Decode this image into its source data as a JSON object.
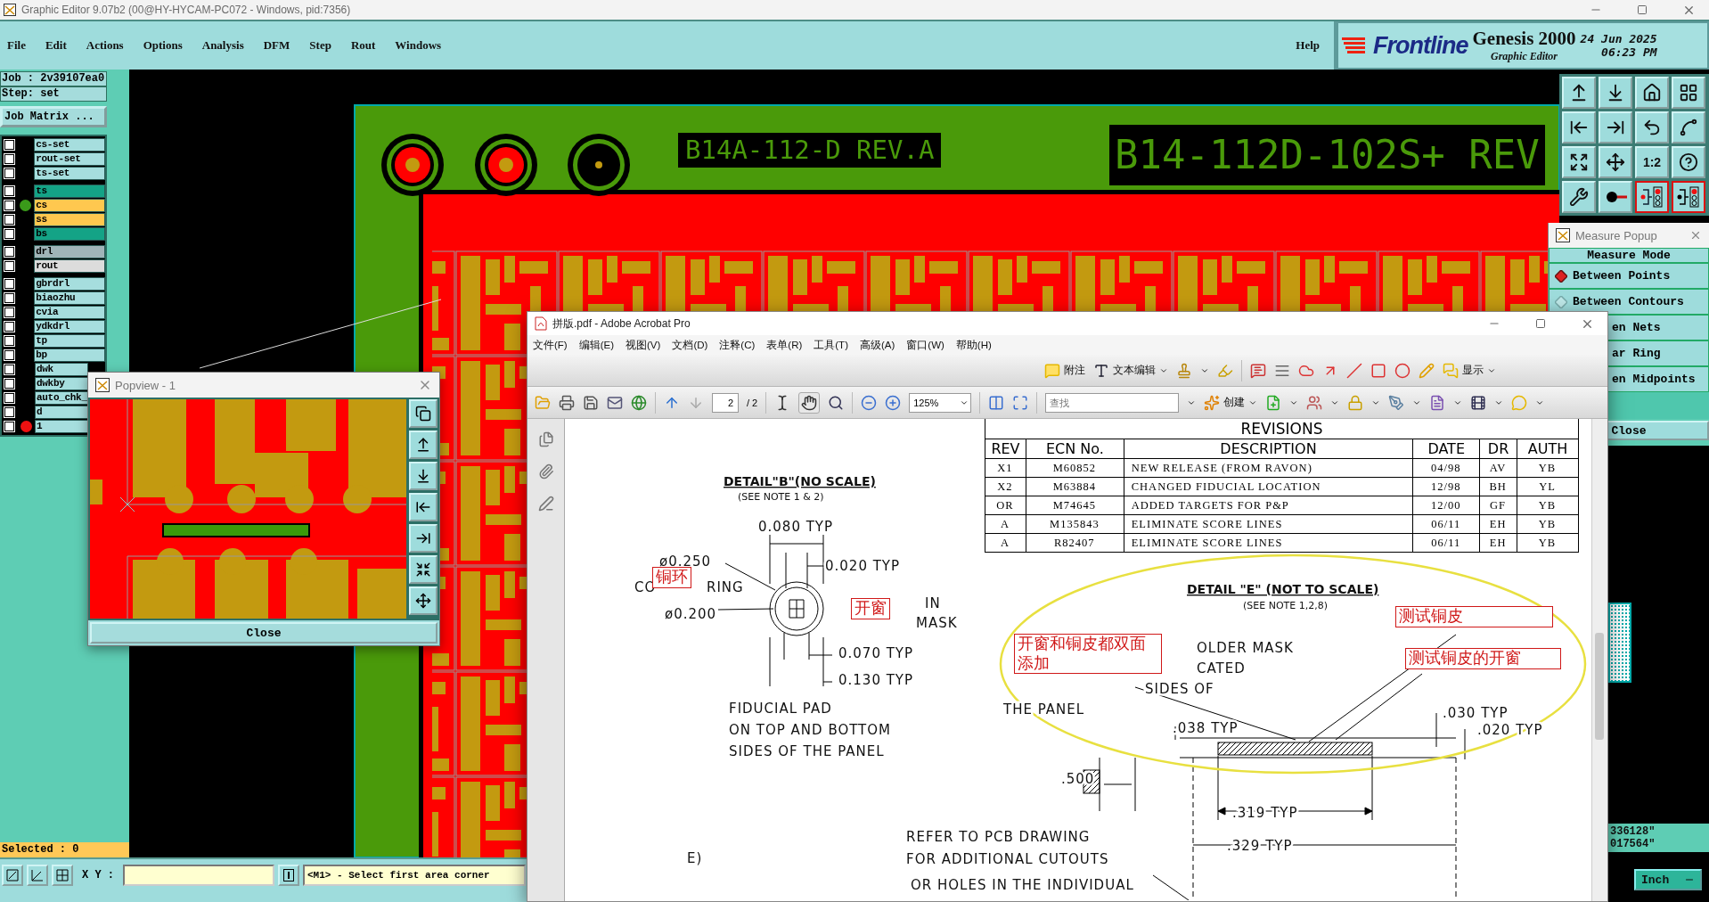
{
  "window": {
    "title": "Graphic Editor 9.07b2 (00@HY-HYCAM-PC072 - Windows, pid:7356)"
  },
  "menu": [
    "File",
    "Edit",
    "Actions",
    "Options",
    "Analysis",
    "DFM",
    "Step",
    "Rout",
    "Windows"
  ],
  "help": "Help",
  "brand": {
    "logo": "Frontline",
    "product": "Genesis 2000",
    "subtitle": "Graphic Editor",
    "date": "24 Jun 2025",
    "time": "06:23 PM"
  },
  "job": {
    "job": "Job : 2v39107ea0",
    "step": "Step: set",
    "matrix_button": "Job Matrix ..."
  },
  "layer_groups": [
    {
      "layers": [
        {
          "name": "cs-set",
          "color": "#a6dede",
          "checked": false
        },
        {
          "name": "rout-set",
          "color": "#a6dede",
          "checked": false
        },
        {
          "name": "ts-set",
          "color": "#a6dede",
          "checked": false
        }
      ]
    },
    {
      "layers": [
        {
          "name": "ts",
          "color": "#14a386",
          "checked": false
        },
        {
          "name": "cs",
          "color": "#ffc84f",
          "checked": false,
          "dot": {
            "color": "#3a9a1a"
          }
        },
        {
          "name": "ss",
          "color": "#ffc84f",
          "checked": false
        },
        {
          "name": "bs",
          "color": "#14a386",
          "checked": false
        }
      ]
    },
    {
      "layers": [
        {
          "name": "drl",
          "color": "#a0b4b8",
          "checked": false
        },
        {
          "name": "rout",
          "color": "#dcdcdc",
          "checked": false
        }
      ]
    },
    {
      "layers": [
        {
          "name": "gbrdrl",
          "color": "#a6dede",
          "checked": false
        },
        {
          "name": "biaozhu",
          "color": "#a6dede",
          "checked": false
        },
        {
          "name": "cvia",
          "color": "#a6dede",
          "checked": false
        },
        {
          "name": "ydkdrl",
          "color": "#a6dede",
          "checked": false
        },
        {
          "name": "tp",
          "color": "#a6dede",
          "checked": false
        },
        {
          "name": "bp",
          "color": "#a6dede",
          "checked": false
        },
        {
          "name": "dwk",
          "color": "#a6dede",
          "checked": false
        },
        {
          "name": "dwkby",
          "color": "#a6dede",
          "checked": false
        },
        {
          "name": "auto_chk_",
          "color": "#a6dede",
          "checked": false
        },
        {
          "name": "d",
          "color": "#a6dede",
          "checked": false
        },
        {
          "name": "1",
          "color": "#a6dede",
          "checked": false,
          "dot": {
            "color": "#ee1111"
          }
        }
      ]
    }
  ],
  "selected_count": "Selected : 0",
  "board_labels": [
    "B14A-112-D REV.A",
    "B14-112D-102S+ REV"
  ],
  "view_toolbar": {
    "scale_label": "1:2"
  },
  "readouts": [
    "336128\"",
    "017564\""
  ],
  "unit_button": "Inch",
  "bottom_bar": {
    "coord_label": "X Y :",
    "message": "<M1> - Select first area corner"
  },
  "popview": {
    "title": "Popview - 1",
    "close": "Close"
  },
  "measure_popup": {
    "title": "Measure Popup",
    "heading": "Measure Mode",
    "options": [
      {
        "label": "Between Points",
        "selected": true,
        "kind": "full"
      },
      {
        "label": "Between Contours",
        "selected": false,
        "kind": "full"
      },
      {
        "label": "en Nets",
        "selected": false,
        "kind": "covered"
      },
      {
        "label": "ar Ring",
        "selected": false,
        "kind": "covered"
      },
      {
        "label": "en Midpoints",
        "selected": false,
        "kind": "covered"
      }
    ],
    "close": "Close"
  },
  "acrobat": {
    "title": "拼版.pdf - Adobe Acrobat Pro",
    "menu": [
      "文件(F)",
      "编辑(E)",
      "视图(V)",
      "文档(D)",
      "注释(C)",
      "表单(R)",
      "工具(T)",
      "高级(A)",
      "窗口(W)",
      "帮助(H)"
    ],
    "toolbar": {
      "comment": "附注",
      "text_edit": "文本编辑",
      "show": "显示",
      "page": "2",
      "page_total": "/ 2",
      "zoom": "125%",
      "search_placeholder": "查找",
      "create": "创建"
    },
    "revisions": {
      "title": "REVISIONS",
      "columns": [
        "REV",
        "ECN No.",
        "DESCRIPTION",
        "DATE",
        "DR",
        "AUTH"
      ],
      "rows": [
        [
          "X1",
          "M60852",
          "NEW RELEASE (FROM RAVON)",
          "04/98",
          "AV",
          "YB"
        ],
        [
          "X2",
          "M63884",
          "CHANGED FIDUCIAL LOCATION",
          "12/98",
          "BH",
          "YL"
        ],
        [
          "OR",
          "M74645",
          "ADDED TARGETS FOR P&P",
          "12/00",
          "GF",
          "YB"
        ],
        [
          "A",
          "M135843",
          "ELIMINATE SCORE LINES",
          "06/11",
          "EH",
          "YB"
        ],
        [
          "A",
          "R82407",
          "ELIMINATE SCORE LINES",
          "06/11",
          "EH",
          "YB"
        ]
      ]
    },
    "drawing_texts": [
      {
        "text": "DETAIL\"B\"(NO SCALE)",
        "kind": "heading"
      },
      {
        "text": "(SEE NOTE 1 & 2)",
        "kind": "note"
      },
      {
        "text": "0.080 TYP",
        "kind": "dim"
      },
      {
        "text": "ø0.250",
        "kind": "dim"
      },
      {
        "text": "0.020 TYP",
        "kind": "dim"
      },
      {
        "text": "CO",
        "kind": "dim"
      },
      {
        "text": "RING",
        "kind": "dim"
      },
      {
        "text": "ø0.200",
        "kind": "dim"
      },
      {
        "text": "IN",
        "kind": "dim"
      },
      {
        "text": "MASK",
        "kind": "dim"
      },
      {
        "text": "0.070 TYP",
        "kind": "dim"
      },
      {
        "text": "0.130 TYP",
        "kind": "dim"
      },
      {
        "text": "FIDUCIAL PAD",
        "kind": "dim"
      },
      {
        "text": "ON TOP AND BOTTOM",
        "kind": "dim"
      },
      {
        "text": "SIDES OF THE PANEL",
        "kind": "dim"
      },
      {
        "text": "DETAIL \"E\" (NOT TO SCALE)",
        "kind": "heading"
      },
      {
        "text": "(SEE NOTE 1,2,8)",
        "kind": "note"
      },
      {
        "text": "OLDER MASK",
        "kind": "dim"
      },
      {
        "text": "CATED",
        "kind": "dim"
      },
      {
        "text": "SIDES OF",
        "kind": "dim"
      },
      {
        "text": "THE PANEL",
        "kind": "dim"
      },
      {
        "text": ".038 TYP",
        "kind": "dim"
      },
      {
        "text": ".030 TYP",
        "kind": "dim"
      },
      {
        "text": ".020 TYP",
        "kind": "dim"
      },
      {
        "text": ".500",
        "kind": "dim"
      },
      {
        "text": ".319 TYP",
        "kind": "dim"
      },
      {
        "text": ".329 TYP",
        "kind": "dim"
      },
      {
        "text": "REFER TO PCB DRAWING",
        "kind": "dim"
      },
      {
        "text": "FOR ADDITIONAL CUTOUTS",
        "kind": "dim"
      },
      {
        "text": "OR HOLES IN THE INDIVIDUAL",
        "kind": "dim"
      },
      {
        "text": "E)",
        "kind": "dim"
      }
    ],
    "annotations": [
      "铜环",
      "开窗",
      "开窗和铜皮都双面添加",
      "测试铜皮",
      "测试铜皮的开窗"
    ]
  }
}
